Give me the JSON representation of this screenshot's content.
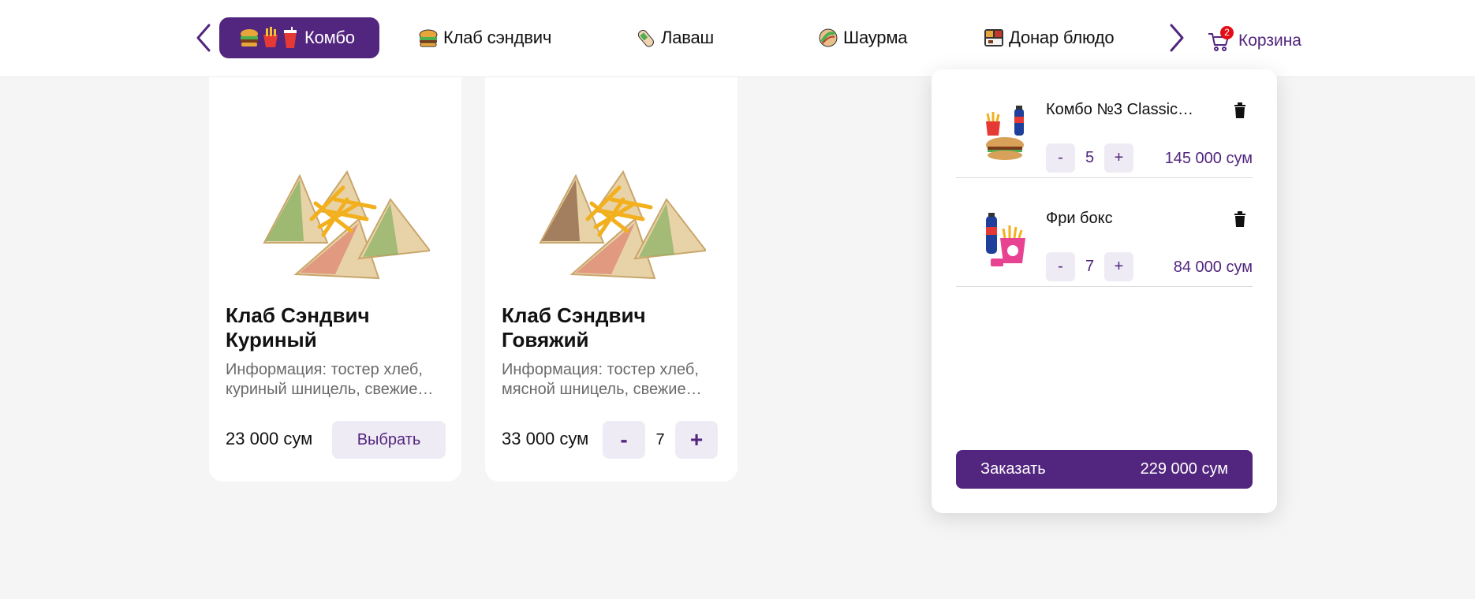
{
  "nav": {
    "tabs": [
      {
        "label": "Комбо",
        "icon": "combo-icon",
        "active": true
      },
      {
        "label": "Клаб сэндвич",
        "icon": "sandwich-icon"
      },
      {
        "label": "Лаваш",
        "icon": "lavash-icon"
      },
      {
        "label": "Шаурма",
        "icon": "shawarma-icon"
      },
      {
        "label": "Донар блюдо",
        "icon": "donar-plate-icon"
      }
    ],
    "accent": "#52257e"
  },
  "cart_link": {
    "label": "Корзина",
    "badge": "2",
    "badge_color": "#e30d17"
  },
  "products": [
    {
      "title": "Клаб Сэндвич Куриный",
      "description": "Информация: тостер хлеб, куриный шницель, свежие…",
      "price": "23 000 сум",
      "button_label": "Выбрать"
    },
    {
      "title": "Клаб Сэндвич Говяжий",
      "description": "Информация: тостер хлеб, мясной шницель, свежие…",
      "price": "33 000 сум",
      "minus_label": "-",
      "quantity": "7",
      "plus_label": "+"
    }
  ],
  "cart": {
    "items": [
      {
        "name": "Комбо №3 Classic…",
        "minus_label": "-",
        "quantity": "5",
        "plus_label": "+",
        "price": "145 000 сум"
      },
      {
        "name": "Фри бокс",
        "minus_label": "-",
        "quantity": "7",
        "plus_label": "+",
        "price": "84 000 сум"
      }
    ],
    "order_label": "Заказать",
    "total": "229 000 сум"
  }
}
